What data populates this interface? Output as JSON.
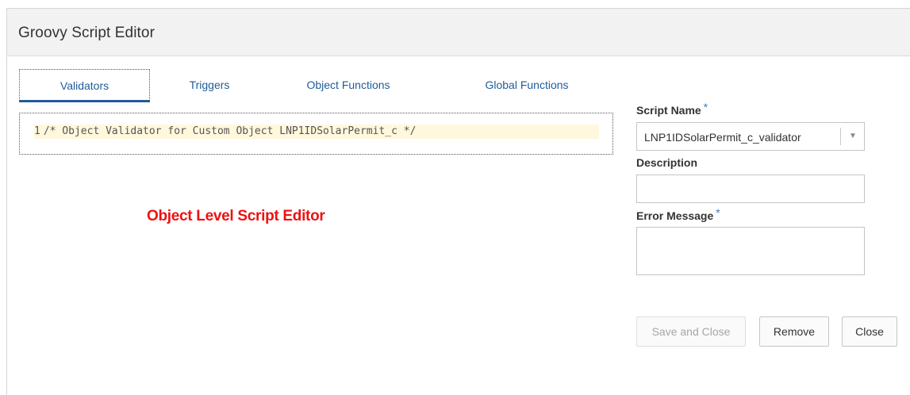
{
  "dialog": {
    "title": "Groovy Script Editor"
  },
  "tabs": [
    {
      "label": "Validators",
      "active": true
    },
    {
      "label": "Triggers",
      "active": false
    },
    {
      "label": "Object Functions",
      "active": false
    },
    {
      "label": "Global Functions",
      "active": false
    }
  ],
  "editor": {
    "line_number": "1",
    "code": "/* Object Validator for Custom Object LNP1IDSolarPermit_c */"
  },
  "annotation": {
    "text": "Object Level Script Editor",
    "color": "#ee1111"
  },
  "form": {
    "script_name_label": "Script Name",
    "script_name_value": "LNP1IDSolarPermit_c_validator",
    "description_label": "Description",
    "description_value": "",
    "error_message_label": "Error Message",
    "error_message_value": "",
    "required_marker": "*"
  },
  "buttons": {
    "save_and_close": "Save and Close",
    "remove": "Remove",
    "close": "Close"
  },
  "icons": {
    "dropdown": "triangle-down-icon"
  },
  "colors": {
    "accent": "#1f5c99",
    "required": "#3a7bbf"
  }
}
